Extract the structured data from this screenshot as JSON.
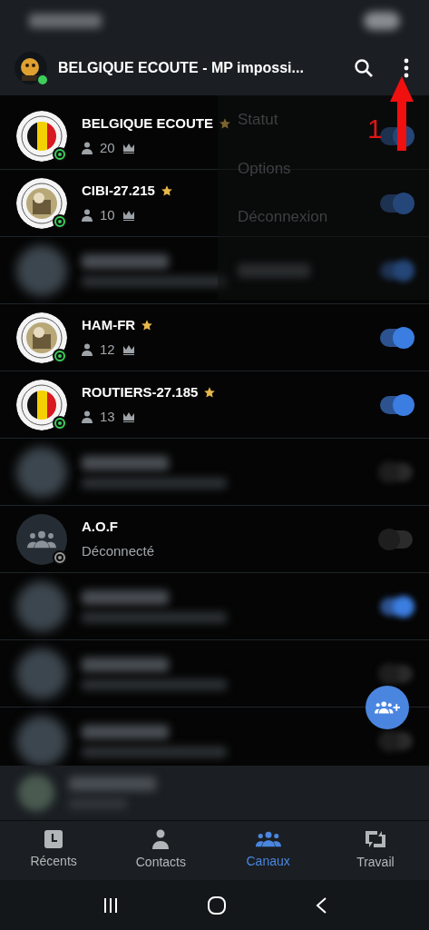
{
  "header": {
    "title": "BELGIQUE ECOUTE - MP impossi...",
    "online": true
  },
  "menu": {
    "items": [
      {
        "kind": "text",
        "label": "Statut"
      },
      {
        "kind": "text",
        "label": "Options"
      },
      {
        "kind": "text",
        "label": "Déconnexion"
      },
      {
        "kind": "blurred"
      }
    ]
  },
  "annotation": {
    "label": "1"
  },
  "channels": [
    {
      "kind": "channel",
      "name": "BELGIQUE ECOUTE",
      "favorite": true,
      "members": "20",
      "online": true,
      "on": true
    },
    {
      "kind": "channel",
      "name": "CIBI-27.215",
      "favorite": true,
      "members": "10",
      "online": true,
      "on": true
    },
    {
      "kind": "blurred",
      "on": true
    },
    {
      "kind": "channel",
      "name": "HAM-FR",
      "favorite": true,
      "members": "12",
      "online": true,
      "on": true
    },
    {
      "kind": "channel",
      "name": "ROUTIERS-27.185",
      "favorite": true,
      "members": "13",
      "online": true,
      "on": true
    },
    {
      "kind": "blurred",
      "on": false
    },
    {
      "kind": "disconnected",
      "name": "A.O.F",
      "status": "Déconnecté",
      "online": false,
      "on": false
    },
    {
      "kind": "blurred",
      "on": true
    },
    {
      "kind": "blurred",
      "on": false
    },
    {
      "kind": "blurred",
      "on": false
    }
  ],
  "tabs": [
    {
      "kind": "recent",
      "label": "Récents",
      "selected": false
    },
    {
      "kind": "contacts",
      "label": "Contacts",
      "selected": false
    },
    {
      "kind": "channels",
      "label": "Canaux",
      "selected": true
    },
    {
      "kind": "work",
      "label": "Travail",
      "selected": false
    }
  ]
}
